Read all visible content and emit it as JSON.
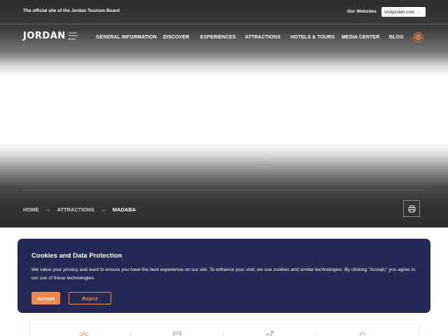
{
  "header": {
    "tagline": "The official site of the Jordan Tourism Board",
    "our_websites_label": "Our Websites",
    "site_selector_value": "visitjordan.com",
    "logo_text": "JORDAN",
    "logo_subtext": "Jordan Tourism Board"
  },
  "nav": {
    "items": [
      {
        "label": "GENERAL INFORMATION"
      },
      {
        "label": "DISCOVER"
      },
      {
        "label": "EXPERIENCES"
      },
      {
        "label": "ATTRACTIONS"
      },
      {
        "label": "HOTELS & TOURS"
      },
      {
        "label": "MEDIA CENTER"
      },
      {
        "label": "BLOG"
      }
    ],
    "language_icon": "globe-icon"
  },
  "breadcrumb": {
    "items": [
      "HOME",
      "ATTRACTIONS",
      "MADABA"
    ],
    "separator_icon": "arrow-right-icon"
  },
  "print_icon": "printer-icon",
  "cookie_banner": {
    "title": "Cookies and Data Protection",
    "text": "We value your privacy and want to ensure you have the best experience on our site. To enhance your visit, we use cookies and similar technologies. By clicking \"Accept,\" you agree to our use of these technologies.",
    "accept_label": "Accept",
    "reject_label": "Reject",
    "colors": {
      "background": "#232a56",
      "accent": "#ee8a4a"
    }
  },
  "info_card": {
    "icons": [
      "sun-icon",
      "calendar-icon",
      "map-pin-icon",
      "weather-icon"
    ]
  }
}
